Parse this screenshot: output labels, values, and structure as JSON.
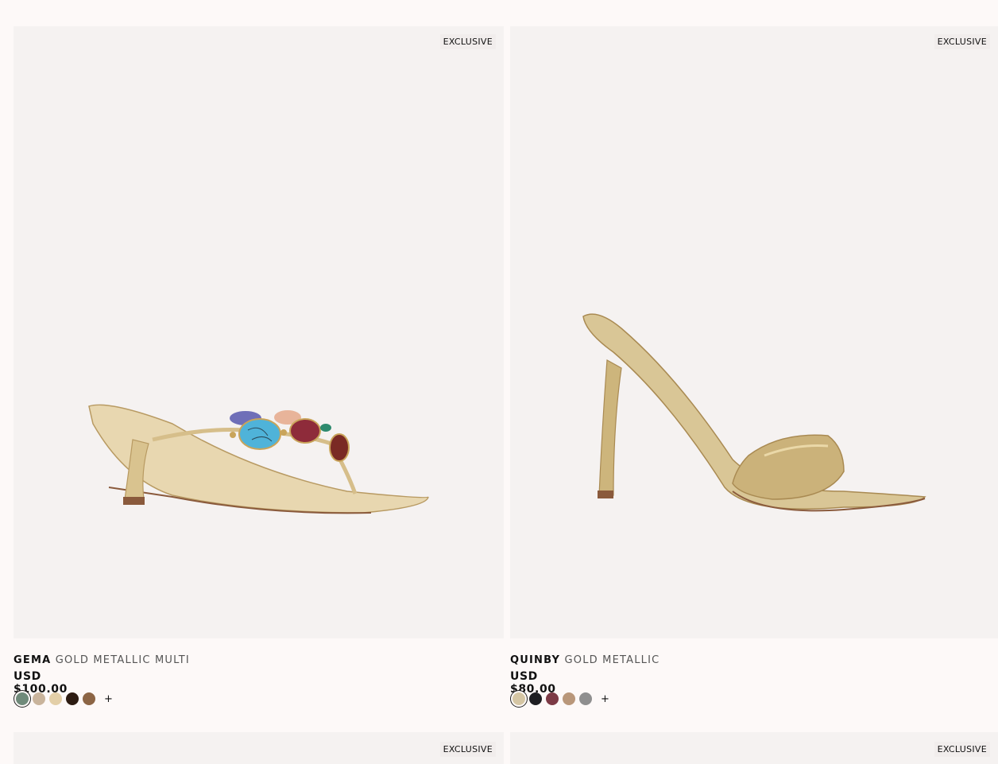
{
  "products": [
    {
      "badge": "EXCLUSIVE",
      "brand": "GEMA",
      "variant": "GOLD METALLIC MULTI",
      "price": "USD $100.00",
      "more": "+",
      "swatches": [
        {
          "color": "#6f8a7a",
          "selected": true
        },
        {
          "color": "#c9b49c",
          "selected": false
        },
        {
          "color": "#e3cfa8",
          "selected": false
        },
        {
          "color": "#2d1c12",
          "selected": false
        },
        {
          "color": "#8c6545",
          "selected": false
        }
      ]
    },
    {
      "badge": "EXCLUSIVE",
      "brand": "QUINBY",
      "variant": "GOLD METALLIC",
      "price": "USD $80.00",
      "more": "+",
      "swatches": [
        {
          "color": "#d5c6a4",
          "selected": true
        },
        {
          "color": "#1e1e22",
          "selected": false
        },
        {
          "color": "#7c3a45",
          "selected": false
        },
        {
          "color": "#b9977a",
          "selected": false
        },
        {
          "color": "#8f8f8f",
          "selected": false
        }
      ]
    }
  ],
  "next_row": [
    {
      "badge": "EXCLUSIVE"
    },
    {
      "badge": "EXCLUSIVE"
    }
  ]
}
